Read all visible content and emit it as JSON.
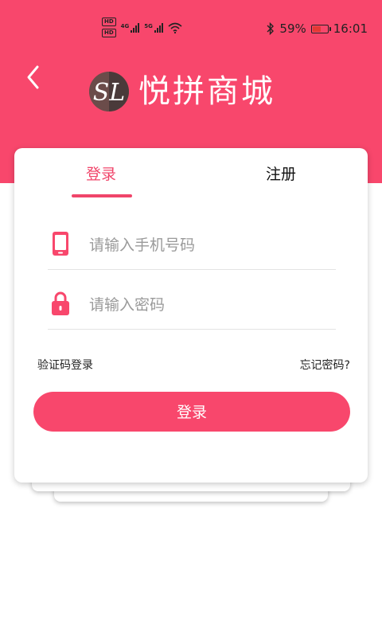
{
  "status_bar": {
    "hd1": "HD",
    "hd2": "HD",
    "net1": "4G",
    "net2": "5G",
    "battery_text": "59%",
    "battery_level": 0.59,
    "time": "16:01"
  },
  "header": {
    "logo_text": "SL",
    "title": "悦拼商城"
  },
  "tabs": [
    {
      "label": "登录",
      "active": true
    },
    {
      "label": "注册",
      "active": false
    }
  ],
  "form": {
    "phone_placeholder": "请输入手机号码",
    "phone_value": "",
    "password_placeholder": "请输入密码",
    "password_value": ""
  },
  "links": {
    "sms_login": "验证码登录",
    "forgot_password": "忘记密码?"
  },
  "login_button": "登录",
  "colors": {
    "brand": "#f8476c",
    "accent": "#f0456a"
  },
  "icons": {
    "back": "chevron-left-icon",
    "phone": "phone-icon",
    "lock": "lock-icon"
  }
}
